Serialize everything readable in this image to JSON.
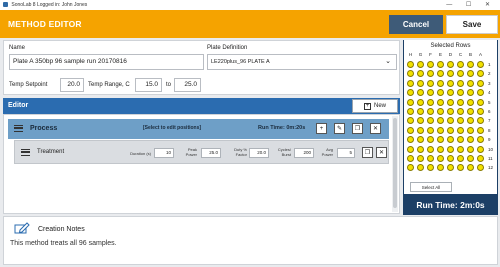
{
  "window": {
    "title": "SonoLab 8 Logged in: John Jones",
    "controls": "— ☐ ✕"
  },
  "header": {
    "title": "METHOD EDITOR",
    "cancel_label": "Cancel",
    "save_label": "Save",
    "accent": "#f5a300"
  },
  "method": {
    "name_label": "Name",
    "name_value": "Plate A 350bp 96 sample run 20170816",
    "plate_label": "Plate Definition",
    "plate_value": "LE220plus_96 PLATE A",
    "temp_setpoint_label": "Temp Setpoint",
    "temp_setpoint_value": "20.0",
    "temp_range_label": "Temp Range, C",
    "temp_range_min": "15.0",
    "temp_range_to": "to",
    "temp_range_max": "25.0"
  },
  "editor": {
    "title": "Editor",
    "new_label": "New",
    "process": {
      "name": "Process",
      "hint": "[Select to edit positions]",
      "run_time": "Run Time: 0m:20s"
    },
    "treatment": {
      "name": "Treatment",
      "duration_label": "Duration (s)",
      "duration_value": "10",
      "peak_power_label": "Peak Power",
      "peak_power_value": "25.0",
      "duty_label": "Duty % Factor",
      "duty_value": "20.0",
      "cycles_label": "Cycles/ Burst",
      "cycles_value": "200",
      "avg_power_label": "Avg Power",
      "avg_power_value": "5"
    }
  },
  "notes": {
    "title": "Creation Notes",
    "text": "This method treats all 96 samples."
  },
  "selected_rows": {
    "title": "Selected Rows",
    "columns": [
      "H",
      "G",
      "F",
      "E",
      "D",
      "C",
      "B",
      "A"
    ],
    "rows": [
      "1",
      "2",
      "3",
      "4",
      "5",
      "6",
      "7",
      "8",
      "9",
      "10",
      "11",
      "12"
    ],
    "all_selected": true,
    "well_color": "#f2e100",
    "select_all_label": "Select All"
  },
  "run_time_total": "Run Time: 2m:0s"
}
